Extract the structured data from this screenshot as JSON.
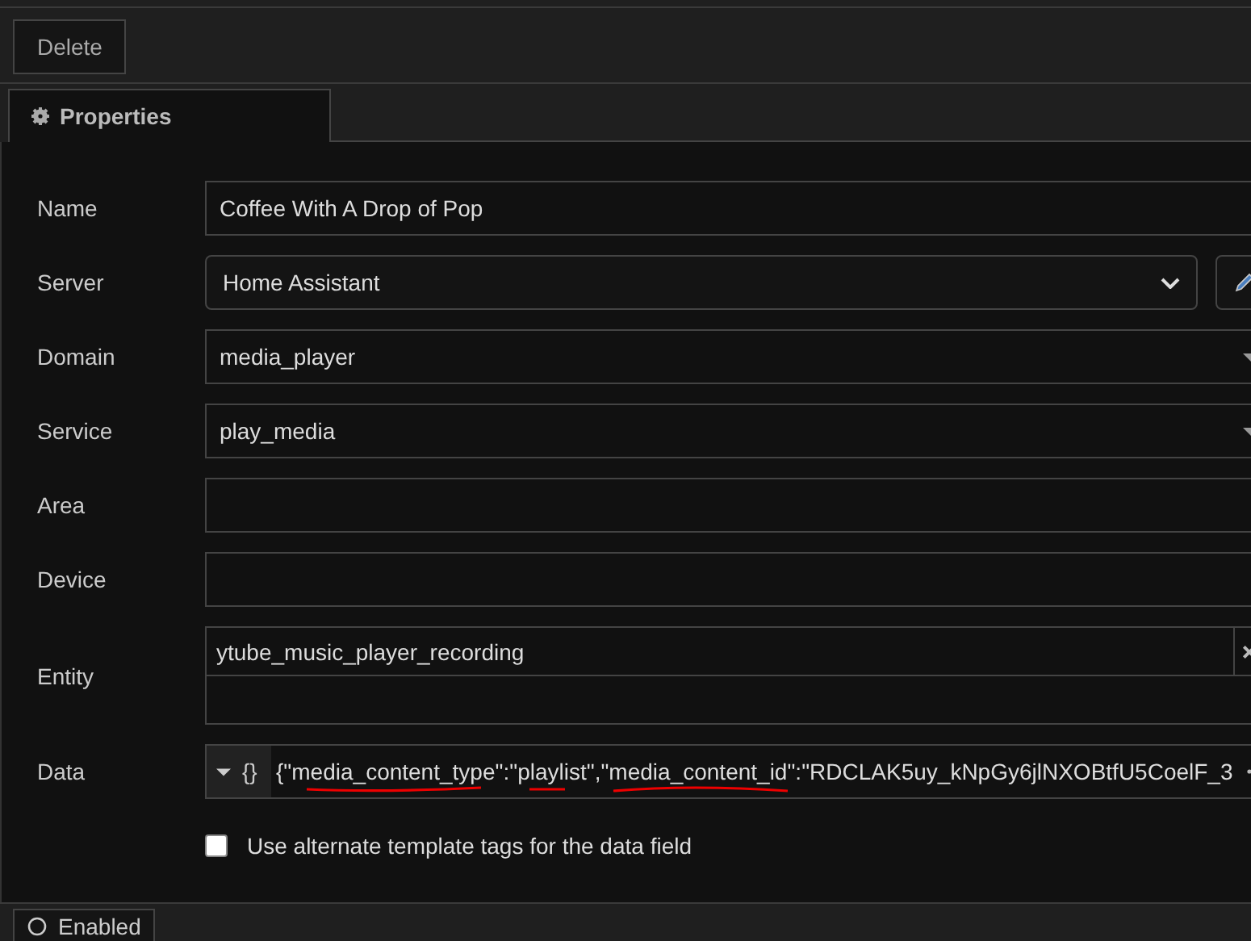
{
  "toolbar": {
    "delete_button": "Delete"
  },
  "tabs": [
    {
      "label": "Properties",
      "selected": true
    }
  ],
  "fields": [
    {
      "label": "Name",
      "kind": "text",
      "value": "Coffee With A Drop of Pop"
    },
    {
      "label": "Server",
      "kind": "select",
      "value": "Home Assistant"
    },
    {
      "label": "Domain",
      "kind": "combo",
      "value": "media_player"
    },
    {
      "label": "Service",
      "kind": "combo",
      "value": "play_media"
    },
    {
      "label": "Area",
      "kind": "text"
    },
    {
      "label": "Device",
      "kind": "text"
    },
    {
      "label": "Entity",
      "kind": "entity",
      "value": "ytube_music_player_recording"
    },
    {
      "label": "Data",
      "kind": "json",
      "type_symbol": "{}",
      "value": "{\"media_content_type\":\"playlist\",\"media_content_id\":\"RDCLAK5uy_kNpGy6jlNXOBtfU5CoelF_3"
    },
    {
      "kind": "checkbox",
      "label": "Use alternate template tags for the data field",
      "checked": false
    }
  ],
  "status_bar": {
    "enabled_button": "Enabled"
  }
}
